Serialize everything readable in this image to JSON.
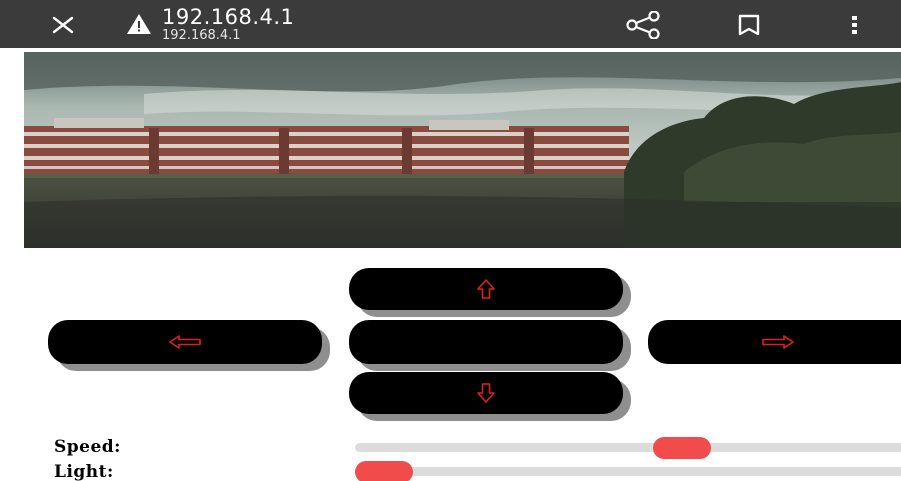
{
  "browser": {
    "url_title": "192.168.4.1",
    "url_subtitle": "192.168.4.1",
    "icons": {
      "close": "close-icon",
      "warning": "warning-triangle-icon",
      "share": "share-icon",
      "bookmark": "bookmark-icon",
      "menu": "kebab-menu-icon"
    }
  },
  "camera": {
    "icon": "camera-feed-image"
  },
  "controls": {
    "up_icon": "arrow-up-icon",
    "left_icon": "arrow-left-icon",
    "stop_icon": "stop-button",
    "right_icon": "arrow-right-icon",
    "down_icon": "arrow-down-icon",
    "arrow_color": "#e02020",
    "button_color": "#000000"
  },
  "sliders": {
    "speed": {
      "label": "Speed:",
      "value_fraction": 0.61
    },
    "light": {
      "label": "Light:",
      "value_fraction": 0.0
    }
  },
  "colors": {
    "topbar": "#3b3b3b",
    "thumb": "#f24b4b",
    "track": "#dcdcdc"
  }
}
